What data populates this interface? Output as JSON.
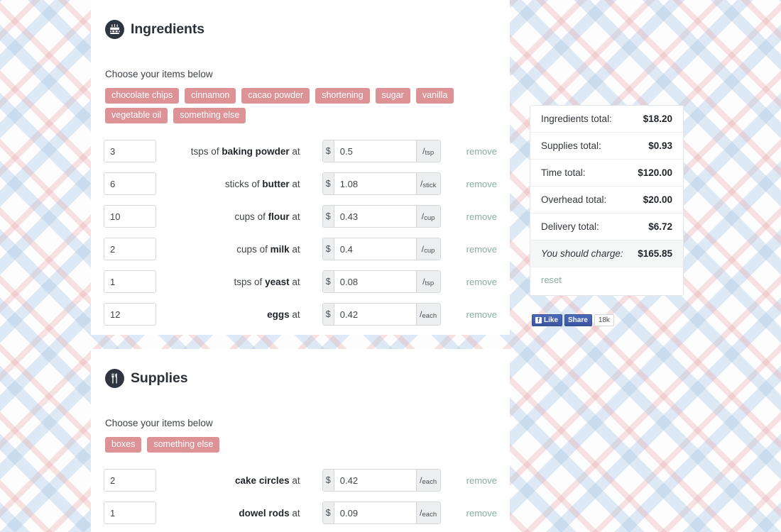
{
  "sections": [
    {
      "id": "ingredients",
      "icon": "cake-icon",
      "title": "Ingredients",
      "choose_label": "Choose your items below",
      "tags": [
        "chocolate chips",
        "cinnamon",
        "cacao powder",
        "shortening",
        "sugar",
        "vanilla",
        "vegetable oil",
        "something else"
      ],
      "rows": [
        {
          "qty": "3",
          "unit_phrase": "tsps of",
          "name": "baking powder",
          "at": "at",
          "currency": "$",
          "price": "0.5",
          "per": "tsp",
          "remove": "remove"
        },
        {
          "qty": "6",
          "unit_phrase": "sticks of",
          "name": "butter",
          "at": "at",
          "currency": "$",
          "price": "1.08",
          "per": "stick",
          "remove": "remove"
        },
        {
          "qty": "10",
          "unit_phrase": "cups of",
          "name": "flour",
          "at": "at",
          "currency": "$",
          "price": "0.43",
          "per": "cup",
          "remove": "remove"
        },
        {
          "qty": "2",
          "unit_phrase": "cups of",
          "name": "milk",
          "at": "at",
          "currency": "$",
          "price": "0.4",
          "per": "cup",
          "remove": "remove"
        },
        {
          "qty": "1",
          "unit_phrase": "tsps of",
          "name": "yeast",
          "at": "at",
          "currency": "$",
          "price": "0.08",
          "per": "tsp",
          "remove": "remove"
        },
        {
          "qty": "12",
          "unit_phrase": "",
          "name": "eggs",
          "at": "at",
          "currency": "$",
          "price": "0.42",
          "per": "each",
          "remove": "remove"
        }
      ]
    },
    {
      "id": "supplies",
      "icon": "utensils-icon",
      "title": "Supplies",
      "choose_label": "Choose your items below",
      "tags": [
        "boxes",
        "something else"
      ],
      "rows": [
        {
          "qty": "2",
          "unit_phrase": "",
          "name": "cake circles",
          "at": "at",
          "currency": "$",
          "price": "0.42",
          "per": "each",
          "remove": "remove"
        },
        {
          "qty": "1",
          "unit_phrase": "",
          "name": "dowel rods",
          "at": "at",
          "currency": "$",
          "price": "0.09",
          "per": "each",
          "remove": "remove"
        }
      ]
    }
  ],
  "totals": {
    "rows": [
      {
        "label": "Ingredients total:",
        "value": "$18.20"
      },
      {
        "label": "Supplies total:",
        "value": "$0.93"
      },
      {
        "label": "Time total:",
        "value": "$120.00"
      },
      {
        "label": "Overhead total:",
        "value": "$20.00"
      },
      {
        "label": "Delivery total:",
        "value": "$6.72"
      }
    ],
    "charge": {
      "label": "You should charge:",
      "value": "$165.85"
    },
    "reset_label": "reset"
  },
  "facebook": {
    "like_label": "Like",
    "share_label": "Share",
    "count": "18k",
    "f_glyph": "f"
  },
  "colors": {
    "tag": "#dd9296",
    "link": "#8aada0",
    "icon_bg": "#2e3440",
    "plaid_blue": "#a8c8e4",
    "plaid_pink": "#e9a8ac"
  }
}
